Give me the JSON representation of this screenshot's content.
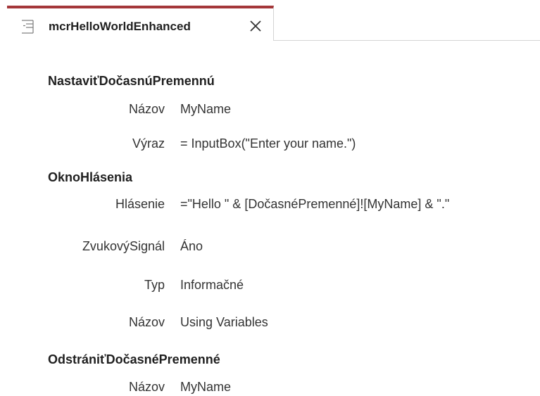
{
  "tab": {
    "title": "mcrHelloWorldEnhanced",
    "icon": "macro-icon",
    "close_icon": "close-icon",
    "accent_color": "#a4373a"
  },
  "macro": {
    "actions": [
      {
        "name": "NastaviťDočasnúPremennú",
        "args": [
          {
            "label": "Názov",
            "value": "MyName"
          },
          {
            "label": "Výraz",
            "value": "= InputBox(\"Enter your name.\")"
          }
        ]
      },
      {
        "name": "OknoHlásenia",
        "args": [
          {
            "label": "Hlásenie",
            "value": "=\"Hello \" & [DočasnéPremenné]![MyName] & \".\""
          },
          {
            "label": "ZvukovýSignál",
            "value": "Áno"
          },
          {
            "label": "Typ",
            "value": "Informačné"
          },
          {
            "label": "Názov",
            "value": "Using Variables"
          }
        ]
      },
      {
        "name": "OdstrániťDočasnéPremenné",
        "args": [
          {
            "label": "Názov",
            "value": "MyName"
          }
        ]
      }
    ]
  }
}
